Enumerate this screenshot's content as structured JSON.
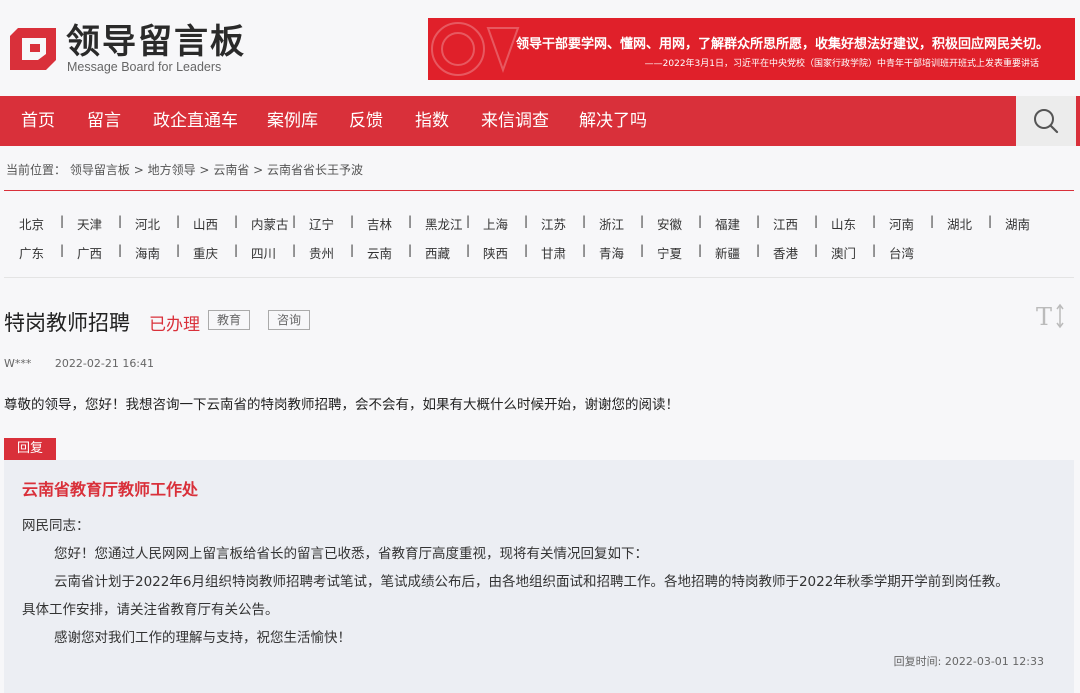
{
  "logo": {
    "title": "领导留言板",
    "subtitle": "Message Board for Leaders"
  },
  "banner": {
    "line1": "领导干部要学网、懂网、用网，了解群众所思所愿，收集好想法好建议，积极回应网民关切。",
    "line2": "——2022年3月1日，习近平在中央党校（国家行政学院）中青年干部培训班开班式上发表重要讲话"
  },
  "nav": {
    "items": [
      "首页",
      "留言",
      "政企直通车",
      "案例库",
      "反馈",
      "指数",
      "来信调查",
      "解决了吗"
    ],
    "search_icon": "search-icon"
  },
  "breadcrumb": {
    "prefix": "当前位置：",
    "items": [
      "领导留言板",
      "地方领导",
      "云南省",
      "云南省省长王予波"
    ],
    "separator": ">"
  },
  "regions": {
    "row1": [
      "北京",
      "天津",
      "河北",
      "山西",
      "内蒙古",
      "辽宁",
      "吉林",
      "黑龙江",
      "上海",
      "江苏",
      "浙江",
      "安徽",
      "福建",
      "江西",
      "山东",
      "河南",
      "湖北",
      "湖南"
    ],
    "row2": [
      "广东",
      "广西",
      "海南",
      "重庆",
      "四川",
      "贵州",
      "云南",
      "西藏",
      "陕西",
      "甘肃",
      "青海",
      "宁夏",
      "新疆",
      "香港",
      "澳门",
      "台湾"
    ],
    "separator": "|"
  },
  "message": {
    "title": "特岗教师招聘",
    "status": "已办理",
    "tags": [
      "教育",
      "咨询"
    ],
    "font_toggle_label": "T↕",
    "author": "W***",
    "time": "2022-02-21 16:41",
    "content": "尊敬的领导，您好！我想咨询一下云南省的特岗教师招聘，会不会有，如果有大概什么时候开始，谢谢您的阅读！"
  },
  "reply": {
    "label": "回复",
    "org": "云南省教育厅教师工作处",
    "greeting": "网民同志：",
    "p1": "您好！您通过人民网网上留言板给省长的留言已收悉，省教育厅高度重视，现将有关情况回复如下：",
    "p2a": "云南省计划于2022年6月组织特岗教师招聘考试笔试，笔试成绩公布后，由各地组织面试和招聘工作。各地招聘的特岗教师于2022年秋季学期开学前到岗任教。",
    "p2b": "具体工作安排，请关注省教育厅有关公告。",
    "p3": "感谢您对我们工作的理解与支持，祝您生活愉快！",
    "time_label": "回复时间:",
    "time": "2022-03-01 12:33"
  },
  "colors": {
    "brand_red": "#d9303a",
    "banner_red": "#e0202a",
    "reply_bg": "#eceef3"
  }
}
